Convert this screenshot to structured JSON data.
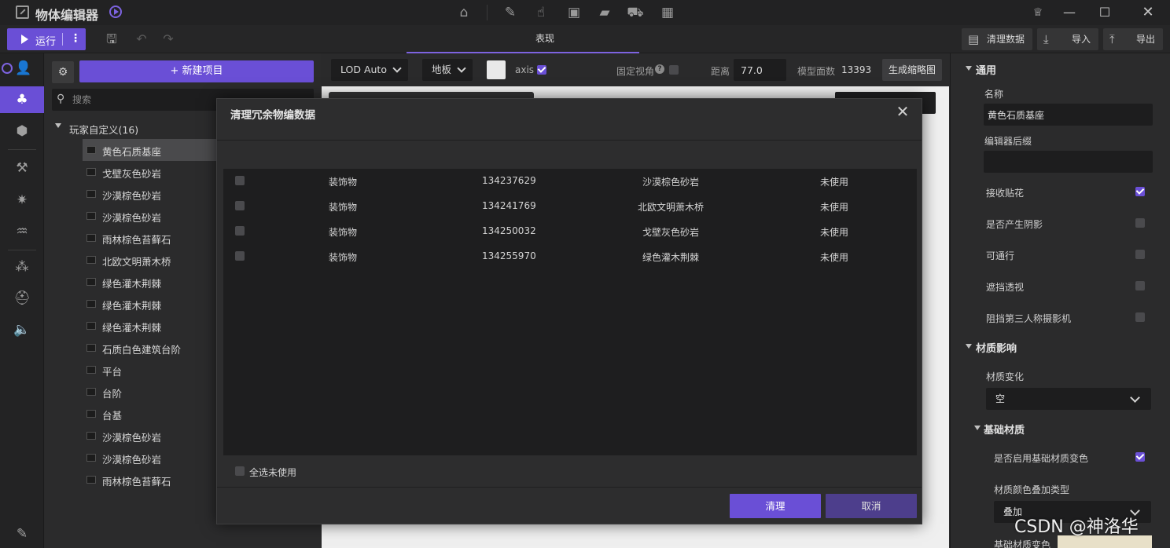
{
  "app": {
    "title": "物体编辑器"
  },
  "toolbar": {
    "run_label": "运行",
    "tab_appearance": "表现",
    "clean_data_label": "清理数据",
    "import_label": "导入",
    "export_label": "导出"
  },
  "tree": {
    "new_project_label": "+ 新建项目",
    "search_placeholder": "搜索",
    "group_label": "玩家自定义(16)",
    "items": [
      {
        "label": "黄色石质基座",
        "selected": true
      },
      {
        "label": "戈壁灰色砂岩"
      },
      {
        "label": "沙漠棕色砂岩"
      },
      {
        "label": "沙漠棕色砂岩"
      },
      {
        "label": "雨林棕色苔藓石"
      },
      {
        "label": "北欧文明萧木桥"
      },
      {
        "label": "绿色灌木荆棘"
      },
      {
        "label": "绿色灌木荆棘"
      },
      {
        "label": "绿色灌木荆棘"
      },
      {
        "label": "石质白色建筑台阶"
      },
      {
        "label": "平台"
      },
      {
        "label": "台阶"
      },
      {
        "label": "台基"
      },
      {
        "label": "沙漠棕色砂岩"
      },
      {
        "label": "沙漠棕色砂岩"
      },
      {
        "label": "雨林棕色苔藓石"
      }
    ]
  },
  "viewport": {
    "lod_label": "LOD Auto",
    "ground_label": "地板",
    "axis_label": "axis",
    "axis_checked": true,
    "fixed_view_label": "固定视角",
    "fixed_view_help": "?",
    "fixed_view_checked": false,
    "distance_label": "距离",
    "distance_value": "77.0",
    "face_count_label": "模型面数",
    "face_count_value": "13393",
    "thumbnail_button": "生成缩略图",
    "swatch_color": "#e9e9e9"
  },
  "properties": {
    "general_title": "通用",
    "name_label": "名称",
    "name_value": "黄色石质基座",
    "suffix_label": "编辑器后缀",
    "suffix_value": "",
    "decal_label": "接收贴花",
    "decal_checked": true,
    "shadow_label": "是否产生阴影",
    "shadow_checked": false,
    "passable_label": "可通行",
    "passable_checked": false,
    "occlusion_label": "遮挡透视",
    "occlusion_checked": false,
    "block_camera_label": "阻挡第三人称摄影机",
    "block_camera_checked": false,
    "material_title": "材质影响",
    "material_change_label": "材质变化",
    "material_change_value": "空",
    "base_material_title": "基础材质",
    "enable_tint_label": "是否启用基础材质变色",
    "enable_tint_checked": true,
    "blend_type_label": "材质颜色叠加类型",
    "blend_type_value": "叠加",
    "base_color_label": "基础材质变色"
  },
  "modal": {
    "title": "清理冗余物编数据",
    "rows": [
      {
        "type": "装饰物",
        "id": "134237629",
        "name": "沙漠棕色砂岩",
        "status": "未使用"
      },
      {
        "type": "装饰物",
        "id": "134241769",
        "name": "北欧文明萧木桥",
        "status": "未使用"
      },
      {
        "type": "装饰物",
        "id": "134250032",
        "name": "戈壁灰色砂岩",
        "status": "未使用"
      },
      {
        "type": "装饰物",
        "id": "134255970",
        "name": "绿色灌木荆棘",
        "status": "未使用"
      }
    ],
    "select_unused_label": "全选未使用",
    "clean_button": "清理",
    "cancel_button": "取消"
  },
  "watermark": "CSDN @神洛华",
  "colors": {
    "accent": "#6a4fd6",
    "accent_dark": "#4d3e8c"
  }
}
